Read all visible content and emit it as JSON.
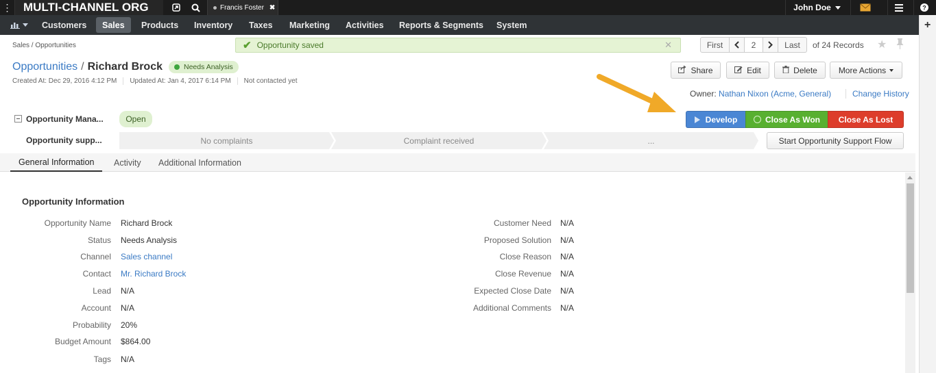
{
  "topbar": {
    "org_name": "MULTI-CHANNEL ORG",
    "pinned_tab": "Francis Foster",
    "user_name": "John Doe"
  },
  "nav": {
    "items": [
      {
        "label": "Customers",
        "active": false
      },
      {
        "label": "Sales",
        "active": true
      },
      {
        "label": "Products",
        "active": false
      },
      {
        "label": "Inventory",
        "active": false
      },
      {
        "label": "Taxes",
        "active": false
      },
      {
        "label": "Marketing",
        "active": false
      },
      {
        "label": "Activities",
        "active": false
      },
      {
        "label": "Reports & Segments",
        "active": false
      },
      {
        "label": "System",
        "active": false
      }
    ]
  },
  "breadcrumb": "Sales / Opportunities",
  "flash_message": "Opportunity saved",
  "pager": {
    "first": "First",
    "page": "2",
    "last": "Last",
    "records": "of 24 Records"
  },
  "title": {
    "entity": "Opportunities",
    "separator": "/",
    "record_name": "Richard Brock",
    "status_badge": "Needs Analysis"
  },
  "meta": {
    "created": "Created At: Dec 29, 2016 4:12 PM",
    "updated": "Updated At: Jan 4, 2017 6:14 PM",
    "contacted": "Not contacted yet"
  },
  "actions": {
    "share": "Share",
    "edit": "Edit",
    "delete": "Delete",
    "more": "More Actions"
  },
  "owner": {
    "label": "Owner:",
    "name": "Nathan Nixon (Acme, General)",
    "change_history": "Change History"
  },
  "workflow": {
    "management_label": "Opportunity Mana...",
    "open_step": "Open",
    "develop": "Develop",
    "close_won": "Close As Won",
    "close_lost": "Close As Lost",
    "support_label": "Opportunity supp...",
    "support_steps": [
      "No complaints",
      "Complaint received",
      "..."
    ],
    "start_support": "Start Opportunity Support Flow"
  },
  "tabs": [
    "General Information",
    "Activity",
    "Additional Information"
  ],
  "section_title": "Opportunity Information",
  "fields_left": [
    {
      "label": "Opportunity Name",
      "value": "Richard Brock",
      "link": false
    },
    {
      "label": "Status",
      "value": "Needs Analysis",
      "link": false
    },
    {
      "label": "Channel",
      "value": "Sales channel",
      "link": true
    },
    {
      "label": "Contact",
      "value": "Mr. Richard Brock",
      "link": true
    },
    {
      "label": "Lead",
      "value": "N/A",
      "link": false
    },
    {
      "label": "Account",
      "value": "N/A",
      "link": false
    },
    {
      "label": "Probability",
      "value": "20%",
      "link": false
    },
    {
      "label": "Budget Amount",
      "value": "$864.00",
      "link": false
    },
    {
      "label": "Tags",
      "value": "N/A",
      "link": false
    }
  ],
  "fields_right": [
    {
      "label": "Customer Need",
      "value": "N/A"
    },
    {
      "label": "Proposed Solution",
      "value": "N/A"
    },
    {
      "label": "Close Reason",
      "value": "N/A"
    },
    {
      "label": "Close Revenue",
      "value": "N/A"
    },
    {
      "label": "Expected Close Date",
      "value": "N/A"
    },
    {
      "label": "Additional Comments",
      "value": "N/A"
    }
  ],
  "colors": {
    "develop": "#4a86d4",
    "won": "#58b030",
    "lost": "#dd3d2b",
    "arrow": "#f0a928",
    "link": "#3a7ac4"
  }
}
